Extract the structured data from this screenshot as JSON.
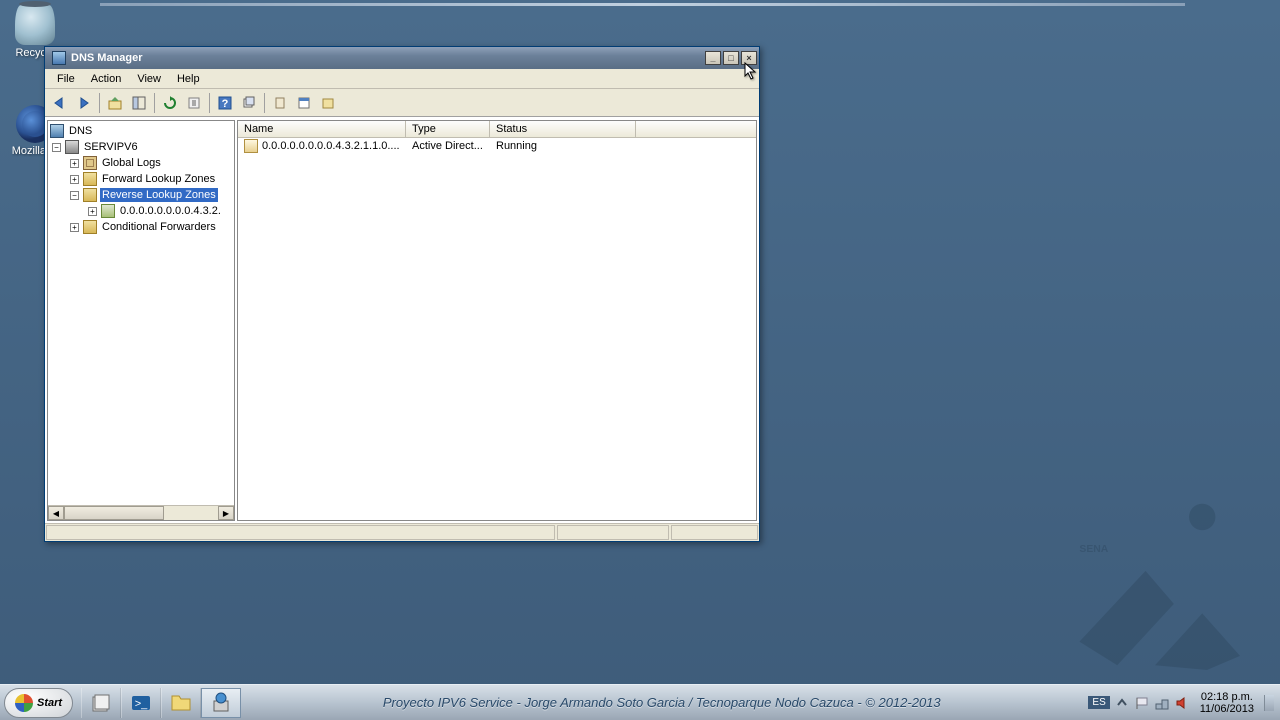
{
  "desktop": {
    "recycle_bin_label": "Recycle",
    "firefox_label": "Mozilla Fi"
  },
  "window": {
    "title": "DNS Manager",
    "menus": {
      "file": "File",
      "action": "Action",
      "view": "View",
      "help": "Help"
    }
  },
  "tree": {
    "root": "DNS",
    "server": "SERVIPV6",
    "global_logs": "Global Logs",
    "fwd": "Forward Lookup Zones",
    "rev": "Reverse Lookup Zones",
    "rev_zone0": "0.0.0.0.0.0.0.0.4.3.2.",
    "cond": "Conditional Forwarders"
  },
  "list": {
    "headers": {
      "name": "Name",
      "type": "Type",
      "status": "Status"
    },
    "rows": [
      {
        "name": "0.0.0.0.0.0.0.0.4.3.2.1.1.0....",
        "type": "Active Direct...",
        "status": "Running"
      }
    ]
  },
  "taskbar": {
    "start": "Start",
    "title_text": "Proyecto IPV6 Service - Jorge Armando Soto Garcia / Tecnoparque Nodo Cazuca - © 2012-2013",
    "lang": "ES",
    "time": "02:18 p.m.",
    "date": "11/06/2013"
  },
  "chart_data": null
}
